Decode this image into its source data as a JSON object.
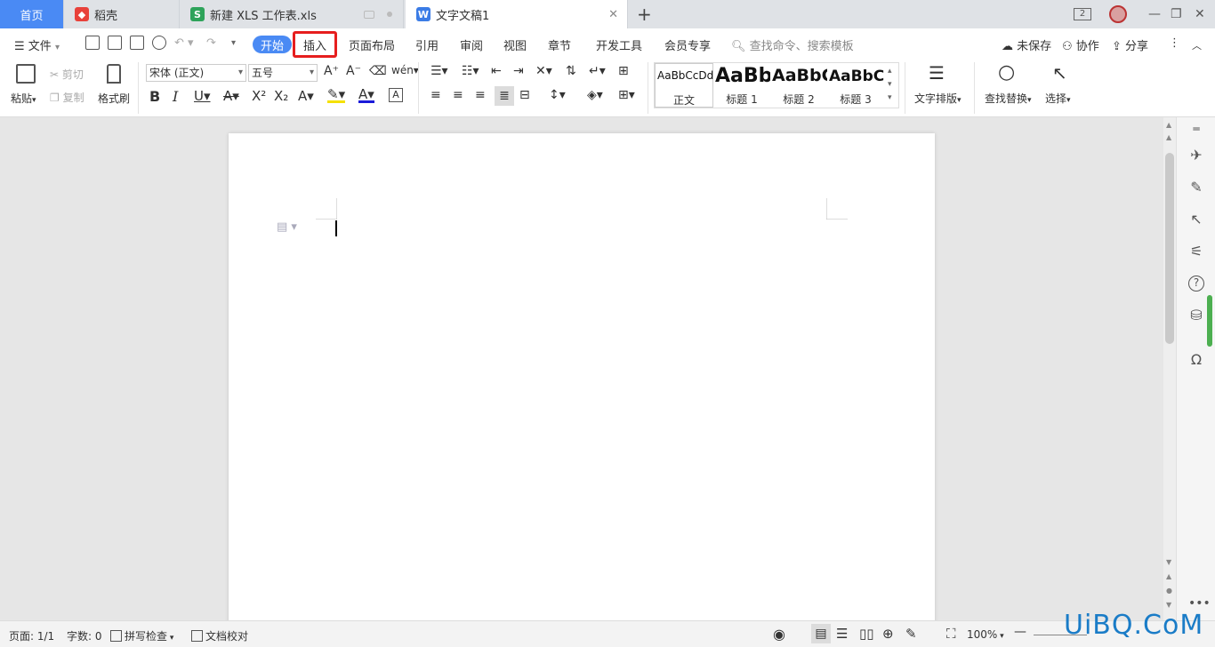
{
  "tabs": {
    "home": "首页",
    "daoke": "稻壳",
    "xls": "新建 XLS 工作表.xls",
    "doc": "文字文稿1",
    "new_tab": "+",
    "window_count": "2"
  },
  "menu": {
    "file": "文件",
    "start": "开始",
    "insert": "插入",
    "layout": "页面布局",
    "references": "引用",
    "review": "审阅",
    "view": "视图",
    "section": "章节",
    "dev_tools": "开发工具",
    "vip": "会员专享",
    "search_placeholder": "查找命令、搜索模板",
    "unsaved": "未保存",
    "collab": "协作",
    "share": "分享"
  },
  "ribbon": {
    "paste": "粘贴",
    "cut": "剪切",
    "copy": "复制",
    "format_painter": "格式刷",
    "font_name": "宋体 (正文)",
    "font_size": "五号",
    "styles": [
      {
        "sample": "AaBbCcDd",
        "name": "正文"
      },
      {
        "sample": "AaBb",
        "name": "标题 1"
      },
      {
        "sample": "AaBbC",
        "name": "标题 2"
      },
      {
        "sample": "AaBbC",
        "name": "标题 3"
      }
    ],
    "text_layout": "文字排版",
    "find_replace": "查找替换",
    "select": "选择"
  },
  "statusbar": {
    "page": "页面: 1/1",
    "word_count": "字数: 0",
    "spell_check": "拼写检查",
    "doc_proof": "文档校对",
    "zoom": "100%"
  },
  "watermark": "UiBQ.CoM",
  "colors": {
    "accent": "#4a8af4",
    "highlight_border": "#e61e1e",
    "watermark": "#1a7cc7"
  }
}
